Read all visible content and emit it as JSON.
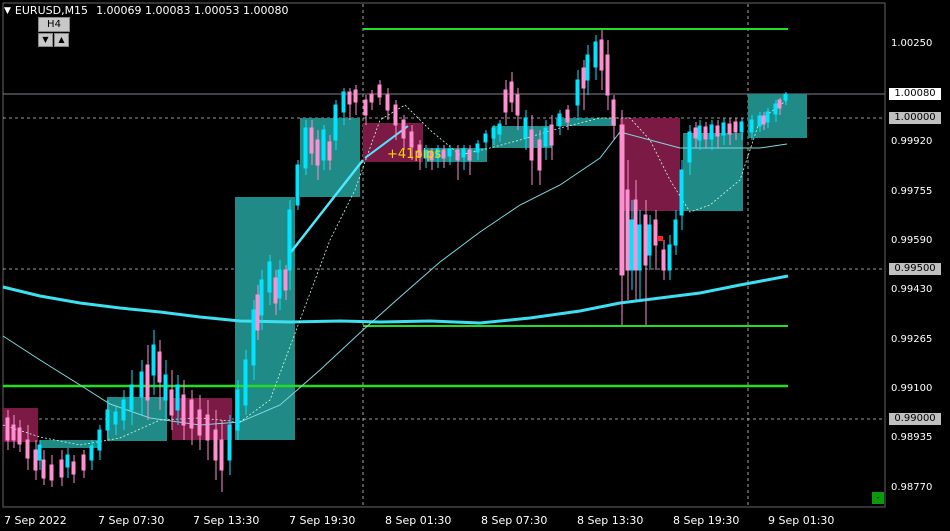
{
  "header": {
    "menu_icon": "triangle-down-icon",
    "symbol": "EURUSD,M15",
    "ohlc": "1.00069 1.00083 1.00053 1.00080"
  },
  "timeframe_button": "H4",
  "arrow_icons": [
    "triangle-down-icon",
    "triangle-up-icon"
  ],
  "profit_label": "+41pips",
  "corner_button": "-",
  "price_axis": {
    "ticks": [
      "1.00250",
      "0.99920",
      "0.99755",
      "0.99590",
      "0.99430",
      "0.99265",
      "0.99100",
      "0.98935",
      "0.98770"
    ],
    "highlighted": [
      {
        "label": "1.00080",
        "bg": "#ffffff",
        "fg": "#000000"
      },
      {
        "label": "1.00000",
        "bg": "#c0c0c0",
        "fg": "#000000"
      },
      {
        "label": "0.99500",
        "bg": "#c0c0c0",
        "fg": "#000000"
      },
      {
        "label": "0.99000",
        "bg": "#c0c0c0",
        "fg": "#000000"
      }
    ]
  },
  "time_axis": [
    "7 Sep 2022",
    "7 Sep 07:30",
    "7 Sep 13:30",
    "7 Sep 19:30",
    "8 Sep 01:30",
    "8 Sep 07:30",
    "8 Sep 13:30",
    "8 Sep 19:30",
    "9 Sep 01:30"
  ],
  "colors": {
    "background": "#000000",
    "bull_candle": "#00e5ff",
    "bear_candle": "#ff8fd0",
    "bull_box": "#1f8a86",
    "bear_box": "#7a1a45",
    "level_line": "#22dd22",
    "ma_thick": "#3de0f0",
    "ma_thin": "#7fd8e0"
  }
}
